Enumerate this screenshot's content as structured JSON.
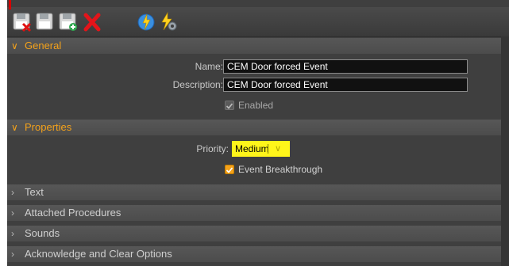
{
  "toolbar": {
    "buttons": [
      {
        "icon": "save-close-icon"
      },
      {
        "icon": "save-icon"
      },
      {
        "icon": "save-new-icon"
      },
      {
        "icon": "delete-icon"
      },
      {
        "icon": "refresh-event-icon"
      },
      {
        "icon": "event-settings-icon"
      }
    ]
  },
  "sections": {
    "general": {
      "title": "General",
      "expanded": true,
      "name_label": "Name:",
      "name_value": "CEM Door forced Event",
      "description_label": "Description:",
      "description_value": "CEM Door forced Event",
      "enabled_label": "Enabled",
      "enabled_checked": true
    },
    "properties": {
      "title": "Properties",
      "expanded": true,
      "priority_label": "Priority:",
      "priority_value": "Medium",
      "breakthrough_label": "Event Breakthrough",
      "breakthrough_checked": true
    },
    "text": {
      "title": "Text",
      "expanded": false
    },
    "procedures": {
      "title": "Attached Procedures",
      "expanded": false
    },
    "sounds": {
      "title": "Sounds",
      "expanded": false
    },
    "acknowledge": {
      "title": "Acknowledge and Clear Options",
      "expanded": false
    }
  },
  "colors": {
    "accent": "#f4a21b",
    "highlight": "#fff51a",
    "background": "#3f3f3f"
  }
}
